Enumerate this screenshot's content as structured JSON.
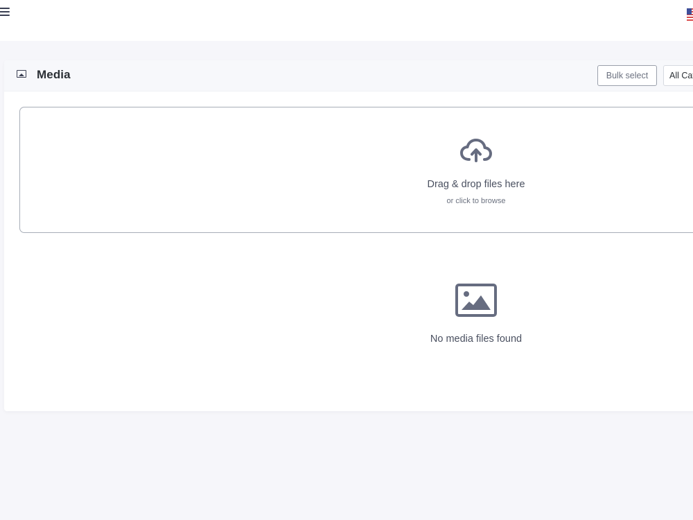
{
  "topbar": {
    "menu_icon": "hamburger-icon",
    "language_icon": "us-flag-icon"
  },
  "media_panel": {
    "title": "Media",
    "title_icon": "image-icon",
    "bulk_select_label": "Bulk select",
    "category_filter": {
      "selected": "All Categories"
    }
  },
  "dropzone": {
    "icon": "cloud-upload-icon",
    "title": "Drag & drop files here",
    "subtitle": "or click to browse"
  },
  "empty_state": {
    "icon": "image-placeholder-icon",
    "message": "No media files found"
  },
  "colors": {
    "page_background": "#f6f6fa",
    "card_header_background": "#f7f8fb",
    "icon_color": "#666c80",
    "text_muted": "#6c7280"
  }
}
